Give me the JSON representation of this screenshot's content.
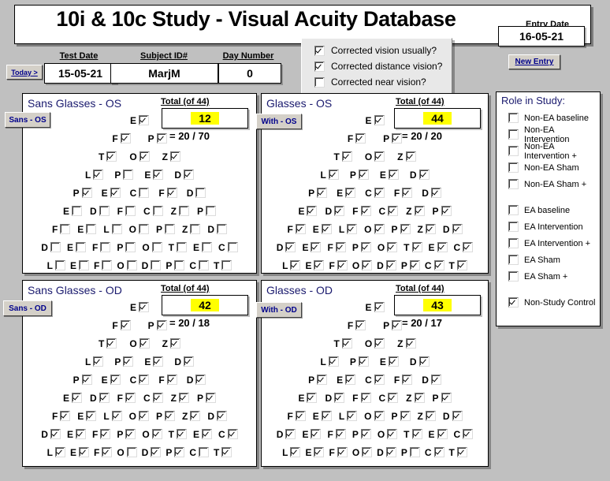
{
  "header": {
    "app_title": "10i & 10c Study - Visual Acuity Database",
    "entry_date_label": "Entry Date",
    "entry_date_value": "16-05-21",
    "new_entry_label": "New Entry",
    "today_label": "Today >",
    "test_date_label": "Test Date",
    "test_date_value": "15-05-21",
    "subject_id_label": "Subject ID#",
    "subject_id_value": "MarjM",
    "day_number_label": "Day Number",
    "day_number_value": "0"
  },
  "correction": {
    "options": [
      {
        "label": "Corrected vision usually?",
        "checked": true
      },
      {
        "label": "Corrected distance vision?",
        "checked": true
      },
      {
        "label": "Corrected near vision?",
        "checked": false
      }
    ]
  },
  "colors": {
    "highlight": "#ffff00",
    "panel_bg": "#ffffff",
    "desktop_bg": "#c0c0c0",
    "button_text": "#00008b",
    "title_text": "#1a1a6e"
  },
  "panels": [
    {
      "id": "sans-os",
      "title": "Sans Glasses - OS",
      "side_button": "Sans - OS",
      "total_label": "Total (of 44)",
      "total_value": "12",
      "ratio": "= 20 / 70",
      "rows": [
        {
          "letters": [
            "E"
          ],
          "checks": [
            true
          ]
        },
        {
          "letters": [
            "F",
            "P"
          ],
          "checks": [
            true,
            true
          ]
        },
        {
          "letters": [
            "T",
            "O",
            "Z"
          ],
          "checks": [
            true,
            true,
            true
          ]
        },
        {
          "letters": [
            "L",
            "P",
            "E",
            "D"
          ],
          "checks": [
            true,
            false,
            true,
            true
          ]
        },
        {
          "letters": [
            "P",
            "E",
            "C",
            "F",
            "D"
          ],
          "checks": [
            true,
            true,
            false,
            true,
            false
          ]
        },
        {
          "letters": [
            "E",
            "D",
            "F",
            "C",
            "Z",
            "P"
          ],
          "checks": [
            false,
            false,
            false,
            false,
            false,
            false
          ]
        },
        {
          "letters": [
            "F",
            "E",
            "L",
            "O",
            "P",
            "Z",
            "D"
          ],
          "checks": [
            false,
            false,
            false,
            false,
            false,
            false,
            false
          ]
        },
        {
          "letters": [
            "D",
            "E",
            "F",
            "P",
            "O",
            "T",
            "E",
            "C"
          ],
          "checks": [
            false,
            false,
            false,
            false,
            false,
            false,
            false,
            false
          ]
        },
        {
          "letters": [
            "L",
            "E",
            "F",
            "O",
            "D",
            "P",
            "C",
            "T"
          ],
          "checks": [
            false,
            false,
            false,
            false,
            false,
            false,
            false,
            false
          ]
        }
      ]
    },
    {
      "id": "with-os",
      "title": "Glasses - OS",
      "side_button": "With - OS",
      "total_label": "Total (of 44)",
      "total_value": "44",
      "ratio": "= 20 / 20",
      "rows": [
        {
          "letters": [
            "E"
          ],
          "checks": [
            true
          ]
        },
        {
          "letters": [
            "F",
            "P"
          ],
          "checks": [
            true,
            true
          ]
        },
        {
          "letters": [
            "T",
            "O",
            "Z"
          ],
          "checks": [
            true,
            true,
            true
          ]
        },
        {
          "letters": [
            "L",
            "P",
            "E",
            "D"
          ],
          "checks": [
            true,
            true,
            true,
            true
          ]
        },
        {
          "letters": [
            "P",
            "E",
            "C",
            "F",
            "D"
          ],
          "checks": [
            true,
            true,
            true,
            true,
            true
          ]
        },
        {
          "letters": [
            "E",
            "D",
            "F",
            "C",
            "Z",
            "P"
          ],
          "checks": [
            true,
            true,
            true,
            true,
            true,
            true
          ]
        },
        {
          "letters": [
            "F",
            "E",
            "L",
            "O",
            "P",
            "Z",
            "D"
          ],
          "checks": [
            true,
            true,
            true,
            true,
            true,
            true,
            true
          ]
        },
        {
          "letters": [
            "D",
            "E",
            "F",
            "P",
            "O",
            "T",
            "E",
            "C"
          ],
          "checks": [
            true,
            true,
            true,
            true,
            true,
            true,
            true,
            true
          ]
        },
        {
          "letters": [
            "L",
            "E",
            "F",
            "O",
            "D",
            "P",
            "C",
            "T"
          ],
          "checks": [
            true,
            true,
            true,
            true,
            true,
            true,
            true,
            true
          ]
        }
      ]
    },
    {
      "id": "sans-od",
      "title": "Sans Glasses - OD",
      "side_button": "Sans - OD",
      "total_label": "Total (of 44)",
      "total_value": "42",
      "ratio": "= 20 / 18",
      "rows": [
        {
          "letters": [
            "E"
          ],
          "checks": [
            true
          ]
        },
        {
          "letters": [
            "F",
            "P"
          ],
          "checks": [
            true,
            true
          ]
        },
        {
          "letters": [
            "T",
            "O",
            "Z"
          ],
          "checks": [
            true,
            true,
            true
          ]
        },
        {
          "letters": [
            "L",
            "P",
            "E",
            "D"
          ],
          "checks": [
            true,
            true,
            true,
            true
          ]
        },
        {
          "letters": [
            "P",
            "E",
            "C",
            "F",
            "D"
          ],
          "checks": [
            true,
            true,
            true,
            true,
            true
          ]
        },
        {
          "letters": [
            "E",
            "D",
            "F",
            "C",
            "Z",
            "P"
          ],
          "checks": [
            true,
            true,
            true,
            true,
            true,
            true
          ]
        },
        {
          "letters": [
            "F",
            "E",
            "L",
            "O",
            "P",
            "Z",
            "D"
          ],
          "checks": [
            true,
            true,
            true,
            true,
            true,
            true,
            true
          ]
        },
        {
          "letters": [
            "D",
            "E",
            "F",
            "P",
            "O",
            "T",
            "E",
            "C"
          ],
          "checks": [
            true,
            true,
            true,
            true,
            true,
            true,
            true,
            true
          ]
        },
        {
          "letters": [
            "L",
            "E",
            "F",
            "O",
            "D",
            "P",
            "C",
            "T"
          ],
          "checks": [
            true,
            true,
            true,
            false,
            true,
            true,
            false,
            true
          ]
        }
      ]
    },
    {
      "id": "with-od",
      "title": "Glasses - OD",
      "side_button": "With - OD",
      "total_label": "Total (of 44)",
      "total_value": "43",
      "ratio": "= 20 / 17",
      "rows": [
        {
          "letters": [
            "E"
          ],
          "checks": [
            true
          ]
        },
        {
          "letters": [
            "F",
            "P"
          ],
          "checks": [
            true,
            true
          ]
        },
        {
          "letters": [
            "T",
            "O",
            "Z"
          ],
          "checks": [
            true,
            true,
            true
          ]
        },
        {
          "letters": [
            "L",
            "P",
            "E",
            "D"
          ],
          "checks": [
            true,
            true,
            true,
            true
          ]
        },
        {
          "letters": [
            "P",
            "E",
            "C",
            "F",
            "D"
          ],
          "checks": [
            true,
            true,
            true,
            true,
            true
          ]
        },
        {
          "letters": [
            "E",
            "D",
            "F",
            "C",
            "Z",
            "P"
          ],
          "checks": [
            true,
            true,
            true,
            true,
            true,
            true
          ]
        },
        {
          "letters": [
            "F",
            "E",
            "L",
            "O",
            "P",
            "Z",
            "D"
          ],
          "checks": [
            true,
            true,
            true,
            true,
            true,
            true,
            true
          ]
        },
        {
          "letters": [
            "D",
            "E",
            "F",
            "P",
            "O",
            "T",
            "E",
            "C"
          ],
          "checks": [
            true,
            true,
            true,
            true,
            true,
            true,
            true,
            true
          ]
        },
        {
          "letters": [
            "L",
            "E",
            "F",
            "O",
            "D",
            "P",
            "C",
            "T"
          ],
          "checks": [
            true,
            true,
            true,
            true,
            true,
            false,
            true,
            true
          ]
        }
      ]
    }
  ],
  "role": {
    "title": "Role in Study:",
    "items": [
      {
        "label": "Non-EA baseline",
        "checked": false,
        "gap_after": false
      },
      {
        "label": "Non-EA Intervention",
        "checked": false,
        "gap_after": false
      },
      {
        "label": "Non-EA Intervention +",
        "checked": false,
        "gap_after": false
      },
      {
        "label": "Non-EA Sham",
        "checked": false,
        "gap_after": false
      },
      {
        "label": "Non-EA Sham +",
        "checked": false,
        "gap_after": true
      },
      {
        "label": "EA baseline",
        "checked": false,
        "gap_after": false
      },
      {
        "label": "EA Intervention",
        "checked": false,
        "gap_after": false
      },
      {
        "label": "EA Intervention +",
        "checked": false,
        "gap_after": false
      },
      {
        "label": "EA Sham",
        "checked": false,
        "gap_after": false
      },
      {
        "label": "EA Sham +",
        "checked": false,
        "gap_after": true
      },
      {
        "label": "Non-Study Control",
        "checked": true,
        "gap_after": false
      }
    ]
  }
}
